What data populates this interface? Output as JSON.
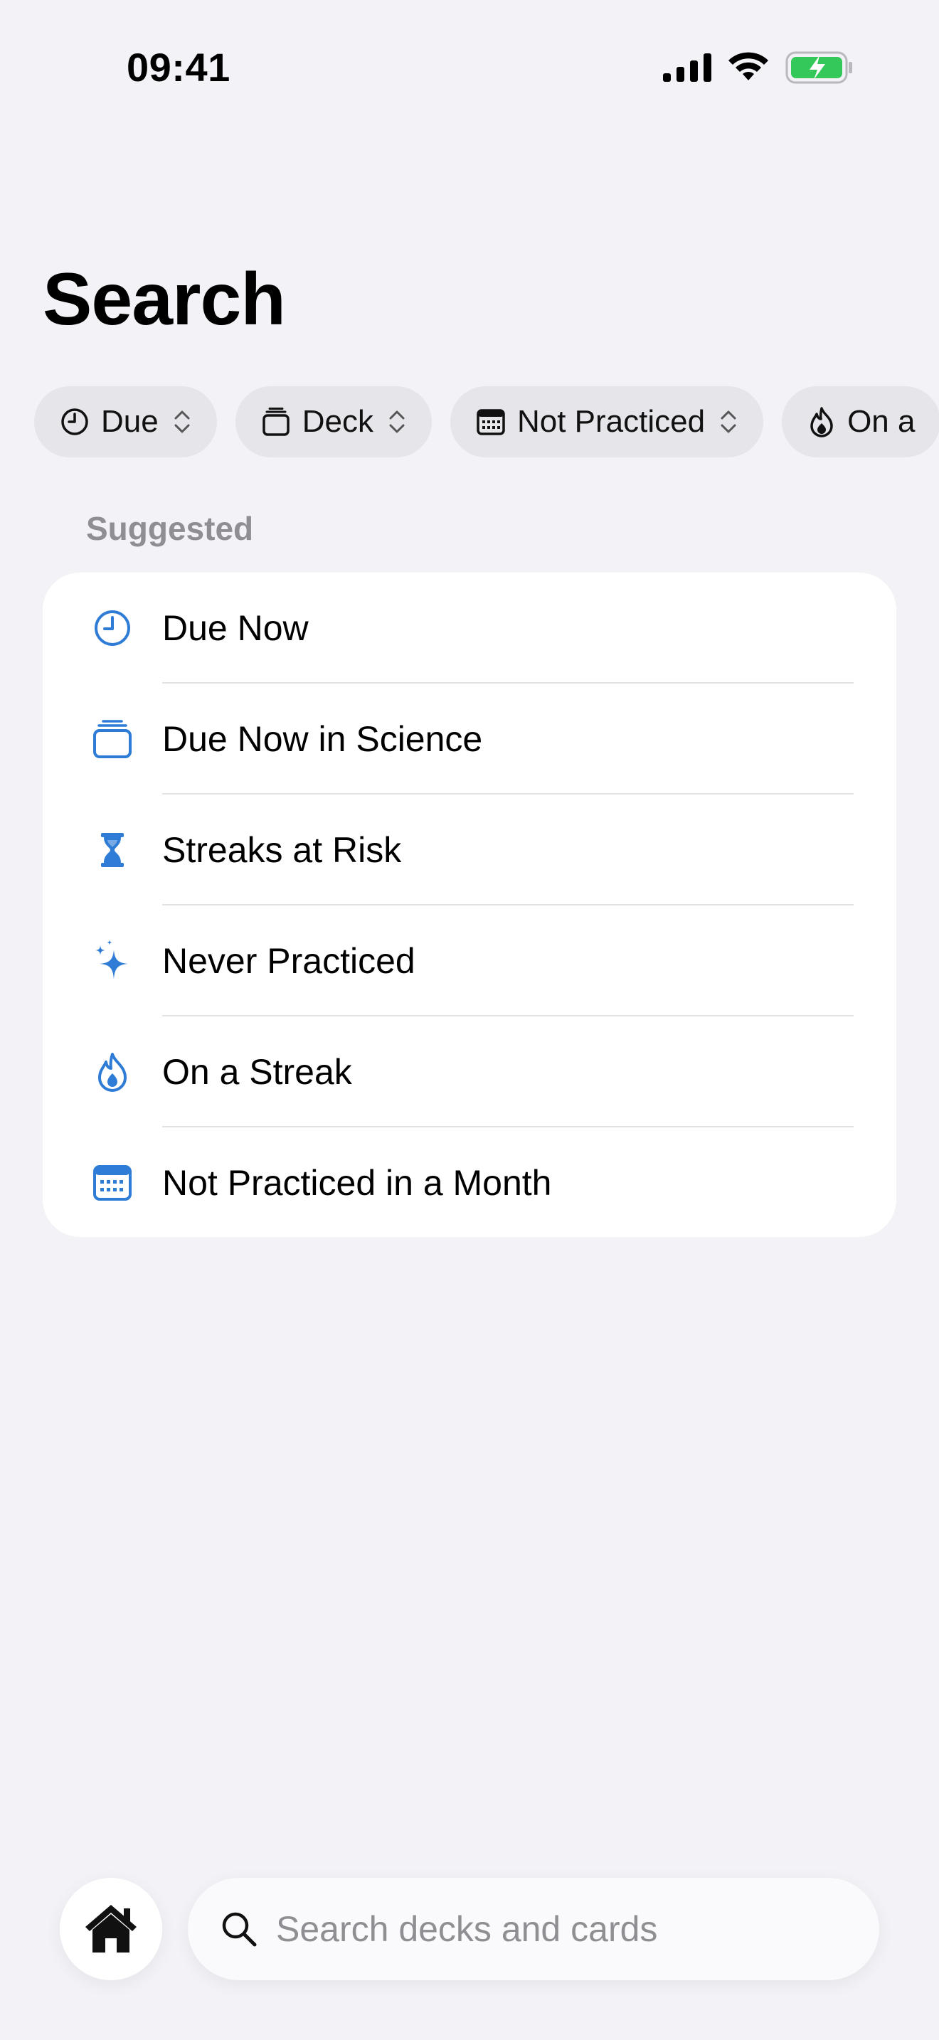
{
  "status_bar": {
    "time": "09:41"
  },
  "header": {
    "title": "Search"
  },
  "filters": [
    {
      "label": "Due",
      "icon": "clock-icon"
    },
    {
      "label": "Deck",
      "icon": "deck-icon"
    },
    {
      "label": "Not Practiced",
      "icon": "calendar-icon"
    },
    {
      "label": "On a",
      "icon": "flame-icon"
    }
  ],
  "suggested": {
    "header": "Suggested",
    "items": [
      {
        "label": "Due Now",
        "icon": "clock-icon"
      },
      {
        "label": "Due Now in Science",
        "icon": "deck-stack-icon"
      },
      {
        "label": "Streaks at Risk",
        "icon": "hourglass-icon"
      },
      {
        "label": "Never Practiced",
        "icon": "sparkles-icon"
      },
      {
        "label": "On a Streak",
        "icon": "flame-icon"
      },
      {
        "label": "Not Practiced in a Month",
        "icon": "calendar-icon"
      }
    ]
  },
  "bottom_bar": {
    "home_icon": "house-icon",
    "search_placeholder": "Search decks and cards"
  },
  "colors": {
    "accent": "#2E7CD6",
    "background": "#F2F2F7",
    "battery": "#34C759"
  }
}
